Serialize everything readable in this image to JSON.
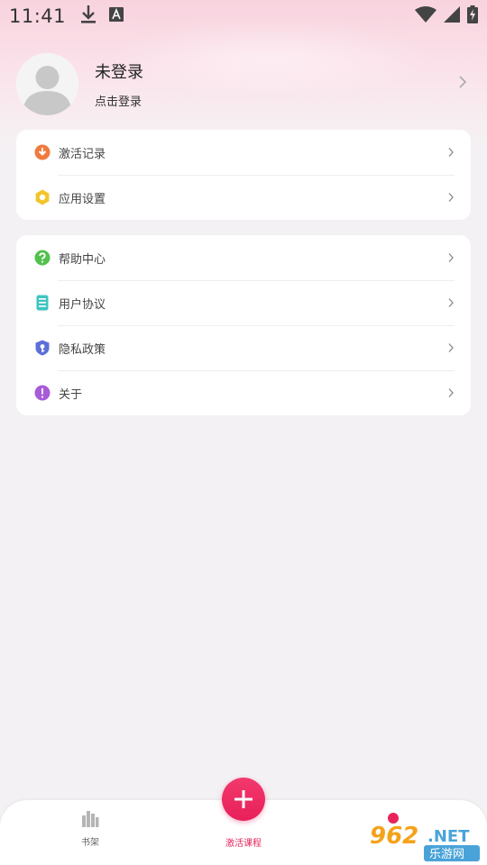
{
  "status_bar": {
    "time": "11:41",
    "left_icons": [
      "download-icon",
      "text-input-icon"
    ],
    "right_icons": [
      "wifi-icon",
      "signal-icon",
      "battery-charging-icon"
    ]
  },
  "profile": {
    "name": "未登录",
    "subtitle": "点击登录"
  },
  "card1": {
    "items": [
      {
        "label": "激活记录",
        "icon": "download-circle-icon",
        "color": "#f07a3e"
      },
      {
        "label": "应用设置",
        "icon": "gear-icon",
        "color": "#f2c52b"
      }
    ]
  },
  "card2": {
    "items": [
      {
        "label": "帮助中心",
        "icon": "help-icon",
        "color": "#53c14d"
      },
      {
        "label": "用户协议",
        "icon": "agreement-icon",
        "color": "#3fc4c0"
      },
      {
        "label": "隐私政策",
        "icon": "shield-key-icon",
        "color": "#5d6fd8"
      },
      {
        "label": "关于",
        "icon": "info-icon",
        "color": "#a85bd8"
      }
    ]
  },
  "bottom_nav": {
    "bookshelf_label": "书架",
    "activate_label": "激活课程",
    "active_color": "#e8245c"
  },
  "watermark": {
    "text_top": "962.NET",
    "text_bottom": "乐游网"
  }
}
